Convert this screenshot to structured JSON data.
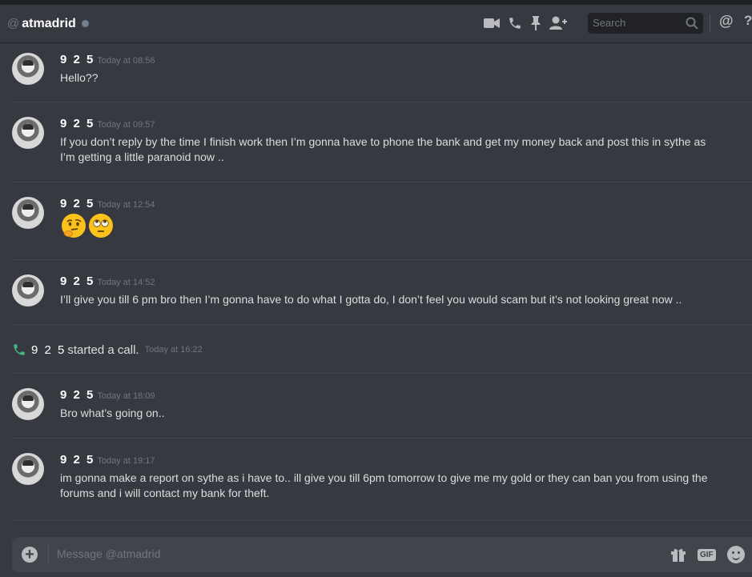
{
  "header": {
    "at_symbol": "@",
    "channel_name": "atmadrid",
    "search_placeholder": "Search",
    "mention_symbol": "@",
    "help_symbol": "?"
  },
  "messages": [
    {
      "author": "9 2 5",
      "time": "Today at 08:56",
      "text": "Hello??"
    },
    {
      "author": "9 2 5",
      "time": "Today at 09:57",
      "text": "If you don’t reply by the time I finish work then I’m gonna have to phone the bank and get my money back and post this in sythe as I’m getting a little paranoid now .."
    },
    {
      "author": "9 2 5",
      "time": "Today at 12:54",
      "emojis": [
        "thinking-face",
        "face-with-rolling-eyes"
      ]
    },
    {
      "author": "9 2 5",
      "time": "Today at 14:52",
      "text": "I’ll give you till 6 pm bro then I’m gonna have to do what I gotta do, I don’t feel you would scam but it’s not looking great now .."
    },
    {
      "author": "9 2 5",
      "time": "Today at 18:09",
      "text": "Bro what’s going on.."
    },
    {
      "author": "9 2 5",
      "time": "Today at 19:17",
      "text": "im gonna make a report on sythe as i have to.. ill give you till 6pm tomorrow to give me my gold or they can ban you from using the forums and i will contact my bank for theft."
    }
  ],
  "system_message": {
    "author": "9 2 5",
    "action": "started a call.",
    "time": "Today at 16:22",
    "icon": "phone-call-icon",
    "icon_color": "#43b581"
  },
  "composer": {
    "placeholder": "Message @atmadrid",
    "gif_label": "GIF"
  },
  "colors": {
    "background": "#36393f",
    "header_text": "#ffffff",
    "muted": "#72767d",
    "body_text": "#dcddde",
    "input_bg": "#40444b",
    "status_offline": "#747f8d"
  }
}
